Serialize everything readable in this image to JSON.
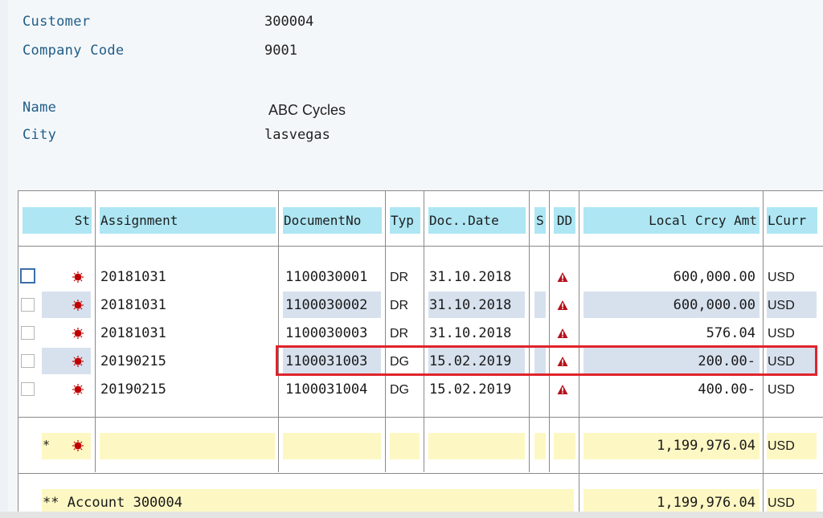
{
  "header": {
    "customer_label": "Customer",
    "customer_value": "300004",
    "company_code_label": "Company Code",
    "company_code_value": "9001",
    "name_label": "Name",
    "name_value": "ABC Cycles",
    "city_label": "City",
    "city_value": "lasvegas"
  },
  "columns": {
    "st": "St",
    "assignment": "Assignment",
    "document_no": "DocumentNo",
    "typ": "Typ",
    "doc_date": "Doc..Date",
    "s": "S",
    "dd": "DD",
    "amount": "Local Crcy Amt",
    "currency": "LCurr"
  },
  "rows": [
    {
      "assignment": "20181031",
      "document_no": "1100030001",
      "typ": "DR",
      "doc_date": "31.10.2018",
      "amount": "600,000.00",
      "currency": "USD"
    },
    {
      "assignment": "20181031",
      "document_no": "1100030002",
      "typ": "DR",
      "doc_date": "31.10.2018",
      "amount": "600,000.00",
      "currency": "USD"
    },
    {
      "assignment": "20181031",
      "document_no": "1100030003",
      "typ": "DR",
      "doc_date": "31.10.2018",
      "amount": "576.04",
      "currency": "USD"
    },
    {
      "assignment": "20190215",
      "document_no": "1100031003",
      "typ": "DG",
      "doc_date": "15.02.2019",
      "amount": "200.00-",
      "currency": "USD"
    },
    {
      "assignment": "20190215",
      "document_no": "1100031004",
      "typ": "DG",
      "doc_date": "15.02.2019",
      "amount": "400.00-",
      "currency": "USD"
    }
  ],
  "subtotal": {
    "marker": "*",
    "amount": "1,199,976.04",
    "currency": "USD"
  },
  "account_total": {
    "label": "** Account 300004",
    "amount": "1,199,976.04",
    "currency": "USD"
  },
  "icons": {
    "status": "status-red-icon",
    "due": "warning-icon"
  },
  "colors": {
    "header_fill": "#aee6f3",
    "band_fill": "#d7e1ee",
    "total_fill": "#fdf7c3",
    "highlight": "#e0232b",
    "status_red": "#c00000"
  }
}
